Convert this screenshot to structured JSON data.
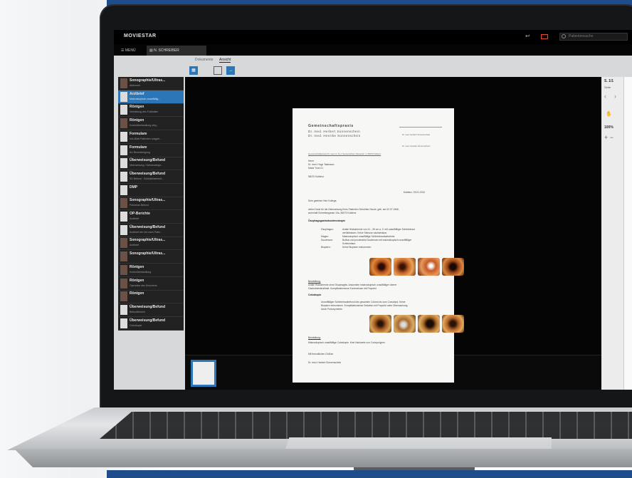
{
  "app": {
    "name": "MOVIESTAR",
    "search_placeholder": "Patientensuche"
  },
  "tabs": {
    "menu": "MENÜ",
    "patient": "N. SCHREIBER"
  },
  "viewer": {
    "tabs": [
      "Dokumente",
      "Ansicht"
    ],
    "ratio_label": "1:1",
    "page_indicator": "S. 1/1",
    "page_label": "Seite",
    "zoom": "100%"
  },
  "documents": [
    {
      "title": "Sonographie/Ultras...",
      "sub": "Abdomen",
      "thumb": "dark"
    },
    {
      "title": "Arztbrief",
      "sub": "Makroskopisch unauffällig...",
      "thumb": "light",
      "active": true
    },
    {
      "title": "Röntgen",
      "sub": "Verhärtung des Fußballen",
      "thumb": "light"
    },
    {
      "title": "Röntgen",
      "sub": "Kontrollbehandlung weg...",
      "thumb": "dark"
    },
    {
      "title": "Formulare",
      "sub": "Info-Blatt Patienten ausgeh...",
      "thumb": "light"
    },
    {
      "title": "Formulare",
      "sub": "AU Bescheinigung",
      "thumb": "light"
    },
    {
      "title": "Überweisung/Befund",
      "sub": "Überweisung / Schwerwiege...",
      "thumb": "light"
    },
    {
      "title": "Überweisung/Befund",
      "sub": "SD Befund - Schilddrüsenent...",
      "thumb": "light"
    },
    {
      "title": "DMP",
      "sub": "",
      "thumb": "light"
    },
    {
      "title": "Sonographie/Ultras...",
      "sub": "Pankreas Befund",
      "thumb": "dark"
    },
    {
      "title": "OP-Berichte",
      "sub": "Arztbrief",
      "thumb": "light"
    },
    {
      "title": "Überweisung/Befund",
      "sub": "Arztbrief der Uni nach Patie...",
      "thumb": "light"
    },
    {
      "title": "Sonographie/Ultras...",
      "sub": "Arztbrief",
      "thumb": "dark"
    },
    {
      "title": "Sonographie/Ultras...",
      "sub": "",
      "thumb": "dark"
    },
    {
      "title": "Röntgen",
      "sub": "Kontrollbehandlung",
      "thumb": "dark"
    },
    {
      "title": "Röntgen",
      "sub": "Operation des Knochens",
      "thumb": "dark"
    },
    {
      "title": "Röntgen",
      "sub": "",
      "thumb": "dark"
    },
    {
      "title": "Überweisung/Befund",
      "sub": "Befundbericht",
      "thumb": "light"
    },
    {
      "title": "Überweisung/Befund",
      "sub": "Coloskopie",
      "thumb": "light"
    }
  ],
  "letter": {
    "practice": "Gemeinschaftspraxis",
    "doctor1": "Dr. med. Herbert Sonnenschein",
    "doctor2": "Dr. med. Henrike Sonnenschein",
    "sender_line": "Gemeinschaftspraxis Dr. med. H. & H. Sonnenschein, Musterstr. 1, 56070 Koblenz",
    "right_col1": "Dr. med. Herbert Sonnenschein",
    "right_col2": "Dr. med. Henrike Sonnenschein",
    "recipient": [
      "Herrn",
      "Dr. med. Hugo Tastmann",
      "Maria Trost 21",
      "",
      "56070 Koblenz"
    ],
    "date": "Koblenz, 03.01.2012",
    "salutation": "Sehr geehrter Herr Kollege,",
    "intro": "vielen Dank für die Überweisung Ihres Patienten Schreiber Nicole, geb. am 02.07.1966,",
    "intro2": "wohnhaft Schreibergasse 10a, 56070 Koblenz",
    "section1": "Ösophagogastroduodenoskopie",
    "findings": [
      [
        "Ösophagus:",
        "Axiale Hiatushernie von 41 - 39 cm a. Z. mit unauffälliger Schleimhaut"
      ],
      [
        "",
        "verhältnissen. Keine Stenose nachweisbar."
      ],
      [
        "Magen:",
        "Makroskopisch unauffällige Schleimhautaufnahme"
      ],
      [
        "Duodenum:",
        "Bulbus und proximales Duodenum mit makroskopisch unauffälliger"
      ],
      [
        "",
        "Schleimhaut."
      ],
      [
        "Biopsien:",
        "Keine Biopsien entnommen."
      ]
    ],
    "assessment_label": "Beurteilung:",
    "assessment1": "Axiale Hiatushernie ohne Ösophagitis. Ansonsten makroskopisch unauffälliger oberer",
    "assessment1b": "Gastrointestinaltrakt. Komplikationslose Kurznarkose mit Propofol.",
    "section2": "Coloskopie",
    "colo": [
      "Unauffälliger Schleimhautbefund  des gesamten Colons bis zum Coecalpol. Keine",
      "Biopsien entnommen. Komplikationslose Sedation mit Propofol unter Überwachung",
      "durch Pulsoxymetrie."
    ],
    "assessment2_label": "Beurteilung:",
    "assessment2": "Makroskopisch unauffällige Coloskopie. Kein Nachweis von Colonpolypen.",
    "closing": "Mit freundlichen Grüßen",
    "signature": "Dr. med. Herbert Sonnenschein"
  }
}
